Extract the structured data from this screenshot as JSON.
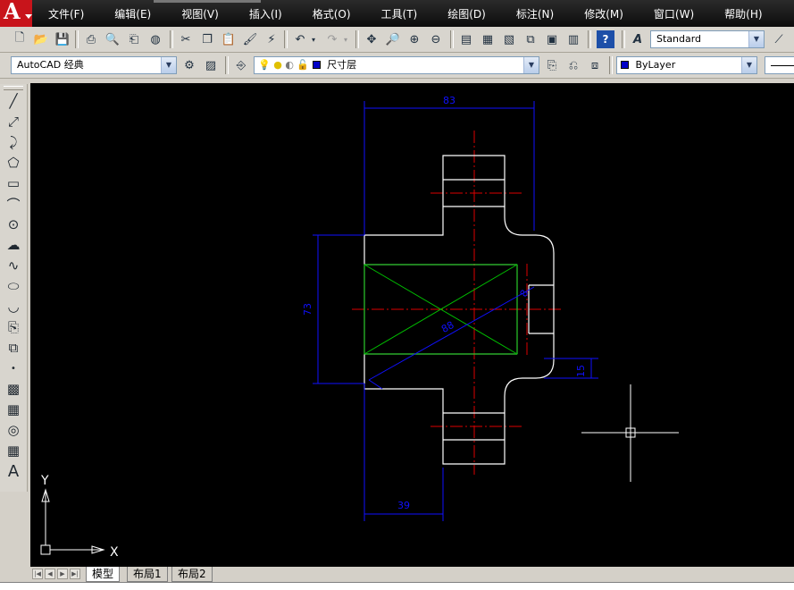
{
  "menu": {
    "items": [
      "文件(F)",
      "编辑(E)",
      "视图(V)",
      "插入(I)",
      "格式(O)",
      "工具(T)",
      "绘图(D)",
      "标注(N)",
      "修改(M)",
      "窗口(W)",
      "帮助(H)"
    ]
  },
  "toolbar1": {
    "text_style": "Standard"
  },
  "toolbar2": {
    "workspace": "AutoCAD 经典",
    "layer": "尺寸层",
    "color": "ByLayer"
  },
  "drawing": {
    "dim_top": "83",
    "dim_left": "73",
    "dim_diag": "88",
    "dim_bottom": "39",
    "dim_right_small": "15",
    "dim_right_gap": "8",
    "ucs_y": "Y",
    "ucs_x": "X",
    "colors": {
      "geometry": "#ffffff",
      "center_line": "#dd0000",
      "dimension": "#1010ff",
      "hatch": "#00c000",
      "background": "#000000"
    }
  },
  "tabs": {
    "items": [
      "模型",
      "布局1",
      "布局2"
    ],
    "active": "模型"
  }
}
